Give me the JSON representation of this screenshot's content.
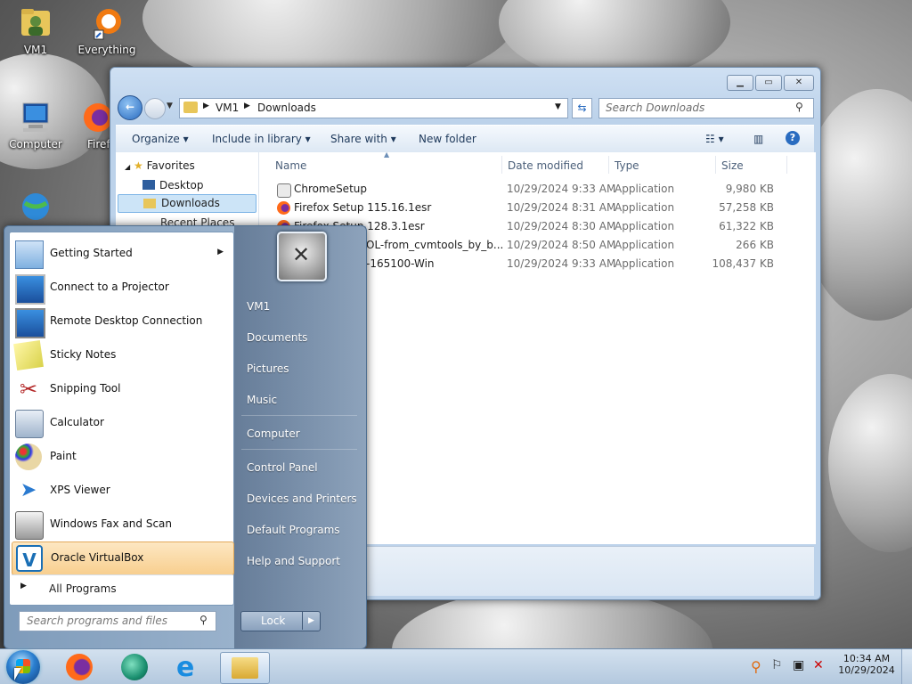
{
  "desktop": {
    "icons": [
      {
        "label": "VM1"
      },
      {
        "label": "Everything"
      },
      {
        "label": "Computer"
      },
      {
        "label": "Firef"
      }
    ]
  },
  "explorer": {
    "breadcrumb": [
      "VM1",
      "Downloads"
    ],
    "search_placeholder": "Search Downloads",
    "toolbar": {
      "organize": "Organize",
      "include": "Include in library",
      "share": "Share with",
      "new_folder": "New folder"
    },
    "nav": {
      "favorites": "Favorites",
      "desktop": "Desktop",
      "downloads": "Downloads",
      "recent": "Recent Places"
    },
    "columns": {
      "name": "Name",
      "date": "Date modified",
      "type": "Type",
      "size": "Size"
    },
    "files": [
      {
        "name": "ChromeSetup",
        "date": "10/29/2024 9:33 AM",
        "type": "Application",
        "size": "9,980 KB"
      },
      {
        "name": "Firefox Setup 115.16.1esr",
        "date": "10/29/2024 8:31 AM",
        "type": "Application",
        "size": "57,258 KB"
      },
      {
        "name": "Firefox Setup 128.3.1esr",
        "date": "10/29/2024 8:30 AM",
        "type": "Application",
        "size": "61,322 KB"
      },
      {
        "name": "OL-from_cvmtools_by_b...",
        "date": "10/29/2024 8:50 AM",
        "type": "Application",
        "size": "266 KB"
      },
      {
        "name": "-165100-Win",
        "date": "10/29/2024 9:33 AM",
        "type": "Application",
        "size": "108,437 KB"
      }
    ]
  },
  "start_menu": {
    "programs": [
      {
        "label": "Getting Started",
        "icon": "getting-started-icon",
        "arrow": true
      },
      {
        "label": "Connect to a Projector",
        "icon": "projector-icon"
      },
      {
        "label": "Remote Desktop Connection",
        "icon": "remote-desktop-icon"
      },
      {
        "label": "Sticky Notes",
        "icon": "sticky-notes-icon"
      },
      {
        "label": "Snipping Tool",
        "icon": "scissors-icon"
      },
      {
        "label": "Calculator",
        "icon": "calculator-icon"
      },
      {
        "label": "Paint",
        "icon": "paint-palette-icon"
      },
      {
        "label": "XPS Viewer",
        "icon": "xps-viewer-icon"
      },
      {
        "label": "Windows Fax and Scan",
        "icon": "fax-icon"
      },
      {
        "label": "Oracle VirtualBox",
        "icon": "virtualbox-icon",
        "highlighted": true
      }
    ],
    "all_programs": "All Programs",
    "search_placeholder": "Search programs and files",
    "right": {
      "user": "VM1",
      "documents": "Documents",
      "pictures": "Pictures",
      "music": "Music",
      "computer": "Computer",
      "control_panel": "Control Panel",
      "devices": "Devices and Printers",
      "default_programs": "Default Programs",
      "help": "Help and Support"
    },
    "lock": "Lock"
  },
  "taskbar": {
    "pinned": [
      "firefox-icon",
      "edge-like-icon",
      "internet-explorer-icon",
      "file-explorer-icon"
    ],
    "clock_time": "10:34 AM",
    "clock_date": "10/29/2024"
  },
  "colors": {
    "highlight": "#f8cf8f",
    "selection": "#cce4f7",
    "accent": "#1e395b"
  }
}
